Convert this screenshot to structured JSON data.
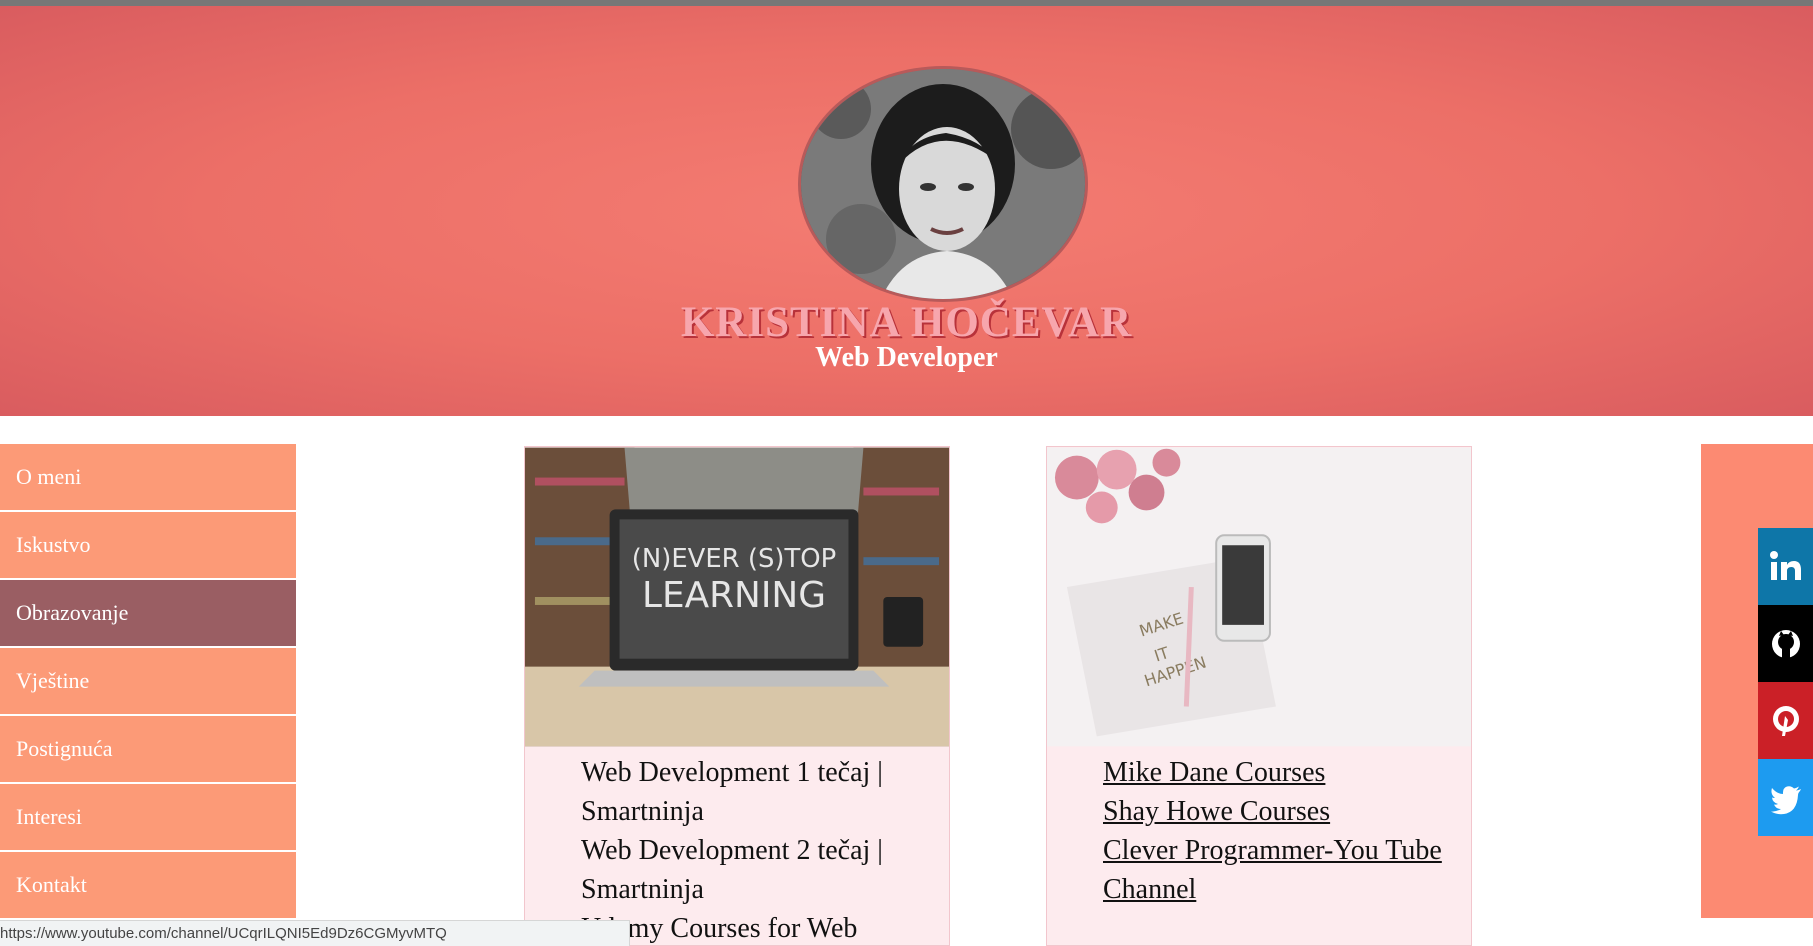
{
  "header": {
    "name": "KRISTINA HOČEVAR",
    "role": "Web Developer"
  },
  "colors": {
    "header_bg": "#ec6f67",
    "nav_bg": "#fc9a77",
    "nav_active_bg": "#9a5e63",
    "card_bg": "#fdebee",
    "right_panel_bg": "#fc8a72"
  },
  "sidebar": {
    "items": [
      {
        "label": "O meni"
      },
      {
        "label": "Iskustvo"
      },
      {
        "label": "Obrazovanje",
        "active": true
      },
      {
        "label": "Vještine"
      },
      {
        "label": "Postignuća"
      },
      {
        "label": "Interesi"
      },
      {
        "label": "Kontakt"
      }
    ]
  },
  "cards": [
    {
      "image_text": [
        "(N)EVER (S)TOP",
        "LEARNING"
      ],
      "items": [
        "Web Development 1 tečaj | Smartninja",
        "Web Development 2 tečaj | Smartninja",
        "Udemy Courses for Web"
      ]
    },
    {
      "image_text": [
        "MAKE",
        "IT",
        "HAPPEN"
      ],
      "items": [
        "Mike Dane Courses",
        "Shay Howe Courses",
        "Clever Programmer-You Tube Channel"
      ]
    }
  ],
  "social": [
    {
      "icon": "linkedin-icon",
      "color": "#0e76a8"
    },
    {
      "icon": "github-icon",
      "color": "#000000"
    },
    {
      "icon": "pinterest-icon",
      "color": "#cb2027"
    },
    {
      "icon": "twitter-icon",
      "color": "#1d9bf0"
    }
  ],
  "status_url": "https://www.youtube.com/channel/UCqrILQNI5Ed9Dz6CGMyvMTQ"
}
